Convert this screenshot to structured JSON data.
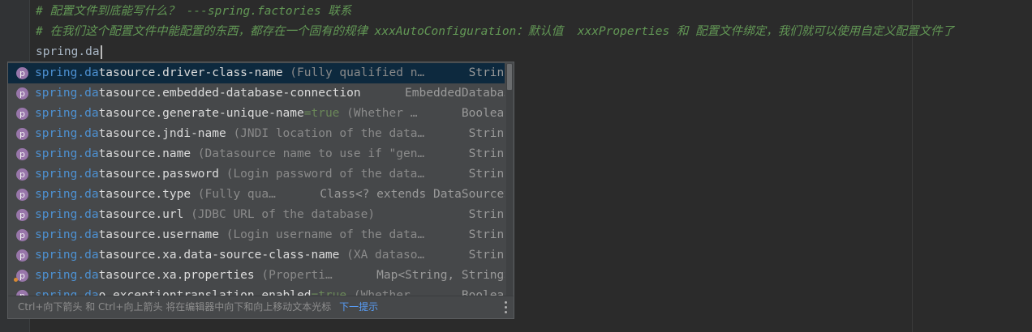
{
  "editor": {
    "comment1": "# 配置文件到底能写什么？ ---spring.factories 联系",
    "comment2": "# 在我们这个配置文件中能配置的东西，都存在一个固有的规律 xxxAutoConfiguration：默认值  xxxProperties 和 配置文件绑定，我们就可以使用自定义配置文件了",
    "typed": "spring.da"
  },
  "completion": {
    "items": [
      {
        "icon": "p",
        "match": "spring.da",
        "rest": "tasource.driver-class-name",
        "eq": "",
        "hint": " (Fully qualified n…",
        "type": "String"
      },
      {
        "icon": "p",
        "match": "spring.da",
        "rest": "tasource.embedded-database-connection",
        "eq": "",
        "hint": "",
        "type": "EmbeddedDataba…"
      },
      {
        "icon": "p",
        "match": "spring.da",
        "rest": "tasource.generate-unique-name",
        "eq": "=true",
        "hint": " (Whether …",
        "type": "Boolean"
      },
      {
        "icon": "p",
        "match": "spring.da",
        "rest": "tasource.jndi-name",
        "eq": "",
        "hint": " (JNDI location of the data…",
        "type": "String"
      },
      {
        "icon": "p",
        "match": "spring.da",
        "rest": "tasource.name",
        "eq": "",
        "hint": " (Datasource name to use if \"gen…",
        "type": "String"
      },
      {
        "icon": "p",
        "match": "spring.da",
        "rest": "tasource.password",
        "eq": "",
        "hint": " (Login password of the data…",
        "type": "String"
      },
      {
        "icon": "p",
        "match": "spring.da",
        "rest": "tasource.type",
        "eq": "",
        "hint": " (Fully qua…",
        "type": "Class<? extends DataSource>"
      },
      {
        "icon": "p",
        "match": "spring.da",
        "rest": "tasource.url",
        "eq": "",
        "hint": " (JDBC URL of the database)",
        "type": "String"
      },
      {
        "icon": "p",
        "match": "spring.da",
        "rest": "tasource.username",
        "eq": "",
        "hint": " (Login username of the data…",
        "type": "String"
      },
      {
        "icon": "p",
        "match": "spring.da",
        "rest": "tasource.xa.data-source-class-name",
        "eq": "",
        "hint": " (XA dataso…",
        "type": "String"
      },
      {
        "icon": "p",
        "match": "spring.da",
        "rest": "tasource.xa.properties",
        "eq": "",
        "hint": " (Properti…",
        "type": "Map<String, String>"
      },
      {
        "icon": "p",
        "match": "spring.da",
        "rest": "o.exceptiontranslation.enabled",
        "eq": "=true",
        "hint": " (Whether…",
        "type": "Boolean"
      }
    ],
    "footer_text": "Ctrl+向下箭头 和 Ctrl+向上箭头 将在编辑器中向下和向上移动文本光标",
    "footer_link": "下一提示"
  },
  "colors": {
    "background": "#2b2b2b",
    "comment": "#629755",
    "popup": "#46484a",
    "selection": "#0d293e",
    "match": "#4d91d2",
    "property_icon": "#9876aa",
    "link": "#589df6"
  }
}
